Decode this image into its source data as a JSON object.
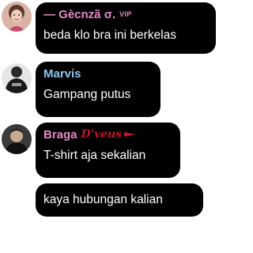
{
  "messages": [
    {
      "sender": "— Gècnzã σ.",
      "badge": "VIP",
      "sender_color": "#e58bc4",
      "text": "beda klo bra ini berkelas",
      "avatar_icon": "profile-photo-woman"
    },
    {
      "sender": "Marvis",
      "sender_color": "#8fc7f0",
      "text": "Gampang putus",
      "avatar_icon": "profile-photo-black-shirt"
    },
    {
      "sender": "Braga",
      "sender_suffix": "D'veus",
      "sender_color": "#e58bc4",
      "suffix_color": "#c0152a",
      "text": "T-shirt aja sekalian",
      "avatar_icon": "profile-photo-man-dark"
    },
    {
      "text": "kaya hubungan kalian"
    }
  ]
}
